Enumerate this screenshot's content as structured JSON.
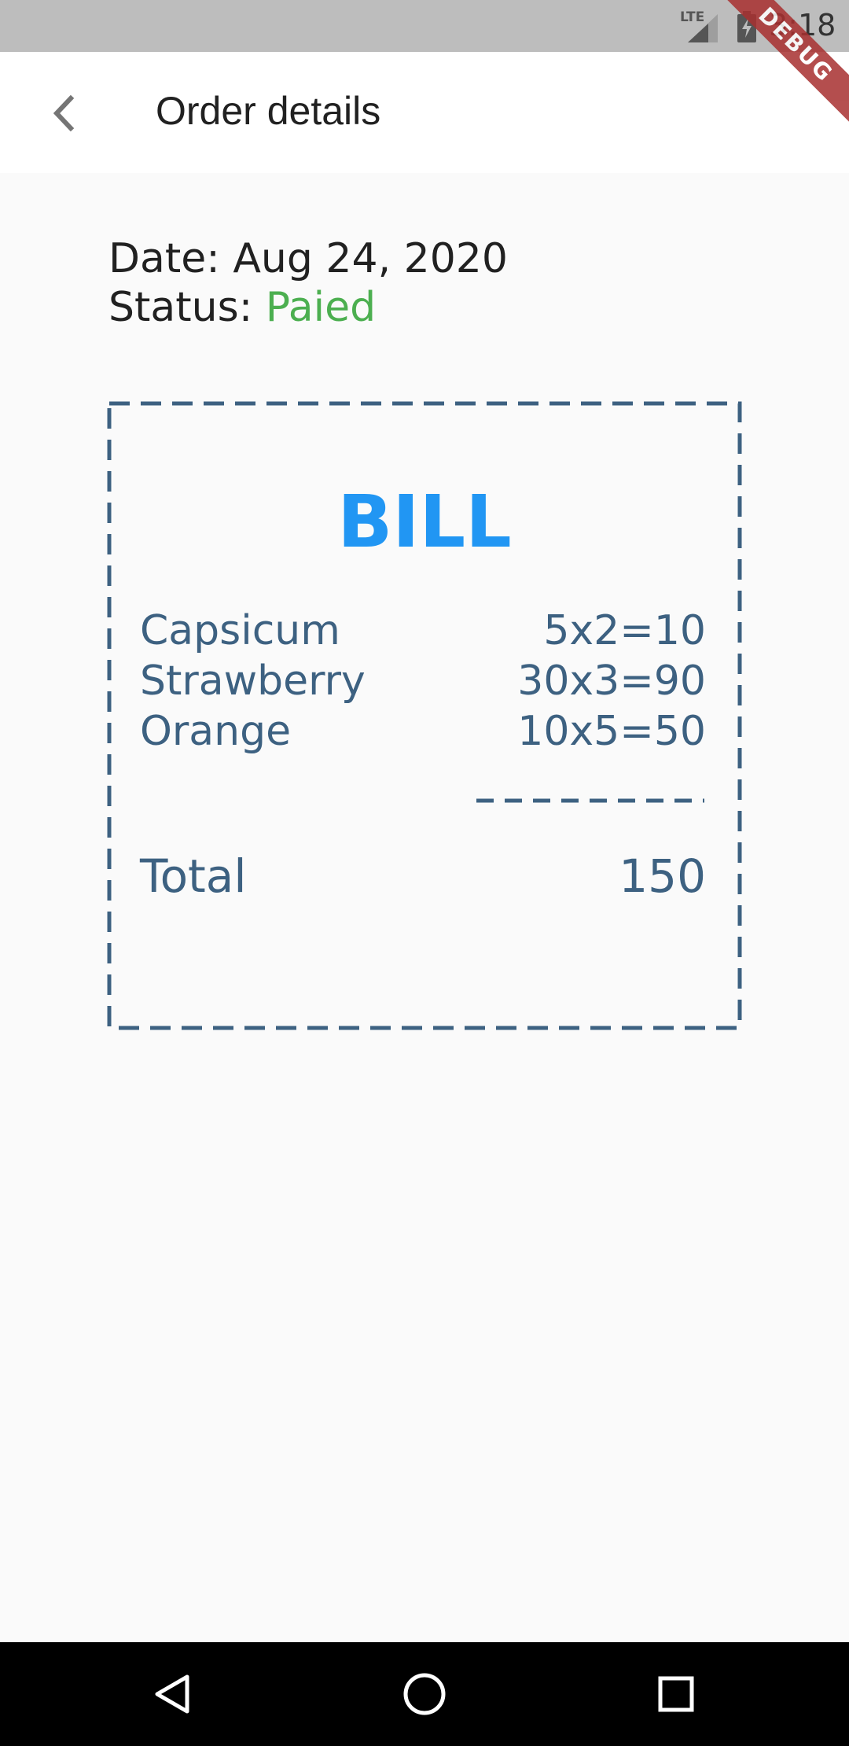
{
  "status_bar": {
    "network": "LTE",
    "time": "3:18",
    "debug_label": "DEBUG"
  },
  "app_bar": {
    "title": "Order details"
  },
  "order": {
    "date_label": "Date:",
    "date_value": "Aug 24, 2020",
    "status_label": "Status:",
    "status_value": "Paied"
  },
  "bill": {
    "title": "BILL",
    "items": [
      {
        "name": "Capsicum",
        "calc": "5x2=10"
      },
      {
        "name": "Strawberry",
        "calc": "30x3=90"
      },
      {
        "name": "Orange",
        "calc": "10x5=50"
      }
    ],
    "total_label": "Total",
    "total_value": "150"
  },
  "colors": {
    "accent": "#2196f3",
    "status_paid": "#4caf50",
    "bill_text": "#3d6181"
  }
}
